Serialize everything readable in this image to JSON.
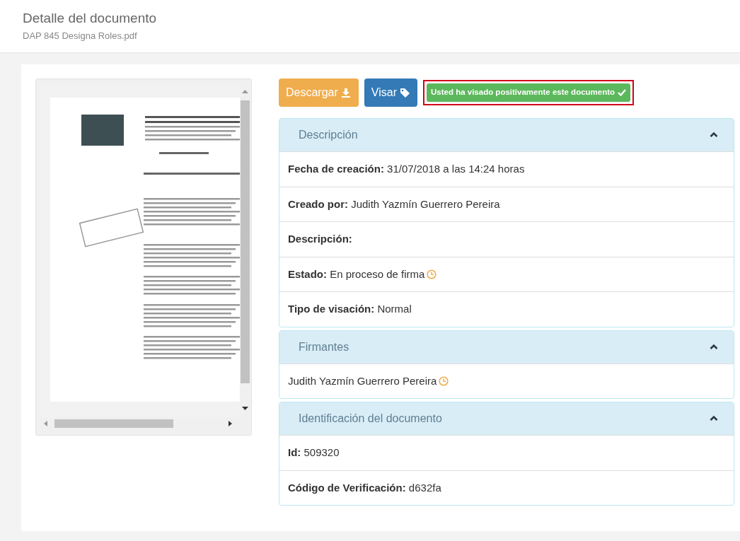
{
  "header": {
    "title": "Detalle del documento",
    "subtitle": "DAP 845 Designa Roles.pdf"
  },
  "actions": [
    {
      "label": "Descargar",
      "kind": "download"
    },
    {
      "label": "Visar",
      "kind": "tag"
    }
  ],
  "status_badge": {
    "text": "Usted ha visado positivamente este documento",
    "highlighted": true
  },
  "panels": [
    {
      "title": "Descripción",
      "expanded": true,
      "rows": [
        {
          "label": "Fecha de creación:",
          "value": "31/07/2018 a las 14:24 horas",
          "pending": false
        },
        {
          "label": "Creado por:",
          "value": "Judith Yazmín Guerrero Pereira",
          "pending": false
        },
        {
          "label": "Descripción:",
          "pending": false
        },
        {
          "label": "Estado:",
          "value": "En proceso de firma",
          "pending": true
        },
        {
          "label": "Tipo de visación:",
          "value": "Normal",
          "pending": false
        }
      ]
    },
    {
      "title": "Firmantes",
      "expanded": true,
      "rows": [
        {
          "value": "Judith Yazmín Guerrero Pereira",
          "pending": true
        }
      ]
    },
    {
      "title": "Identificación del documento",
      "expanded": true,
      "rows": [
        {
          "label": "Id:",
          "value": "509320",
          "pending": false
        },
        {
          "label": "Código de Verificación:",
          "value": "d632fa",
          "pending": false
        }
      ]
    }
  ]
}
